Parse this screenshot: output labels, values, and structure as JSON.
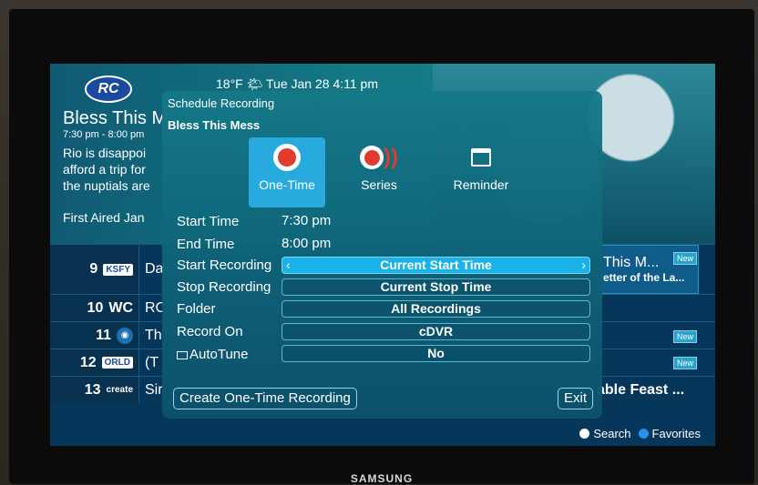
{
  "tv": {
    "brand": "SAMSUNG"
  },
  "header": {
    "logo_text": "RC",
    "status": "18°F 🌤 Tue Jan 28 4:11 pm",
    "program_title": "Bless This M",
    "program_time": "7:30 pm - 8:00 pm",
    "description_lines": [
      "Rio is disappoi",
      "afford a trip for",
      "the nuptials are"
    ],
    "first_aired": "First Aired Jan"
  },
  "guide": {
    "rows": [
      {
        "number": "9",
        "logo": "KSFY",
        "program": "Da",
        "right_title": "This M...",
        "right_sub": "etter of the La...",
        "badge": "New"
      },
      {
        "number": "10",
        "logo": "WC",
        "program": "RC"
      },
      {
        "number": "11",
        "logo": "◉",
        "program": "Th",
        "badge": "New"
      },
      {
        "number": "12",
        "logo": "ORLD",
        "program": "(T",
        "badge": "New"
      },
      {
        "number": "13",
        "logo": "create",
        "program": "Sir",
        "right_title": "able Feast ..."
      }
    ],
    "legend": {
      "search": "Search",
      "favorites": "Favorites"
    },
    "colors": {
      "search_dot": "#ffffff",
      "favorites_dot": "#2a8ff0"
    }
  },
  "dialog": {
    "title": "Schedule Recording",
    "show": "Bless This Mess",
    "options": [
      {
        "label": "One-Time",
        "icon": "record-icon",
        "selected": true
      },
      {
        "label": "Series",
        "icon": "series-record-icon",
        "selected": false
      },
      {
        "label": "Reminder",
        "icon": "calendar-icon",
        "selected": false
      }
    ],
    "start_time_label": "Start Time",
    "start_time": "7:30 pm",
    "end_time_label": "End Time",
    "end_time": "8:00 pm",
    "start_recording_label": "Start Recording",
    "start_recording": "Current Start Time",
    "stop_recording_label": "Stop Recording",
    "stop_recording": "Current Stop Time",
    "folder_label": "Folder",
    "folder": "All Recordings",
    "record_on_label": "Record On",
    "record_on": "cDVR",
    "autotune_label": "AutoTune",
    "autotune": "No",
    "create_button": "Create One-Time Recording",
    "exit_button": "Exit"
  }
}
